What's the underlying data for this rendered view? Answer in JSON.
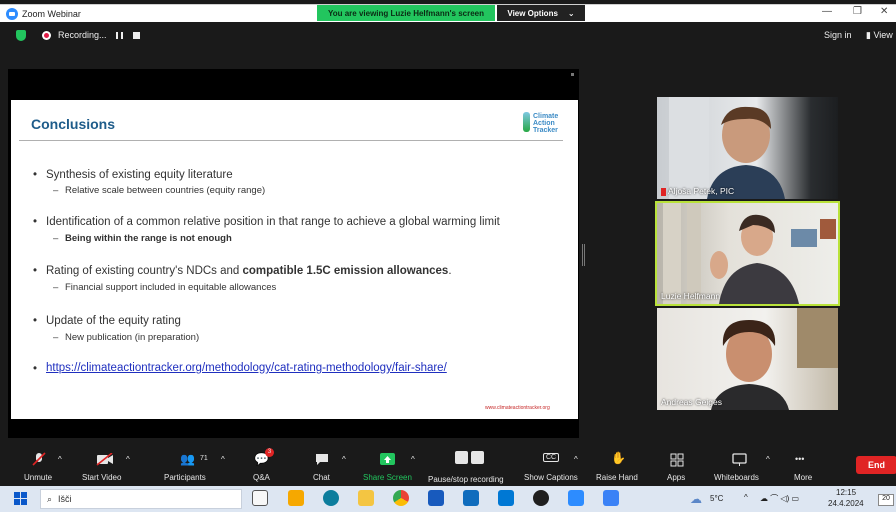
{
  "window": {
    "title": "Zoom Webinar",
    "minimize": "—",
    "restore": "❐",
    "close": "✕"
  },
  "banner": {
    "viewing": "You are viewing Luzie Helfmann's screen",
    "view_options": "View Options",
    "chevron": "⌄"
  },
  "topbar": {
    "recording": "Recording...",
    "sign_in": "Sign in",
    "view": "View"
  },
  "slide": {
    "title": "Conclusions",
    "logo": [
      "Climate",
      "Action",
      "Tracker"
    ],
    "bullets": [
      {
        "text": "Synthesis of existing equity literature",
        "sub": "Relative scale between countries (equity range)"
      },
      {
        "text": "Identification of a common relative position in that range to achieve a global warming limit",
        "sub": "Being within the range is not enough"
      },
      {
        "text_pre": "Rating of existing country's NDCs and ",
        "text_bold": "compatible 1.5C emission allowances",
        "text_post": ".",
        "sub": "Financial support included in equitable allowances"
      },
      {
        "text": "Update of the equity rating",
        "sub": "New publication (in preparation)"
      },
      {
        "link": "https://climateactiontracker.org/methodology/cat-rating-methodology/fair-share/"
      }
    ],
    "bullet_char": "•",
    "dash": "–",
    "footer": "www.climateactiontracker.org"
  },
  "participants": [
    {
      "name": "Aljoša Petek, PIC"
    },
    {
      "name": "Luzie Helfmann"
    },
    {
      "name": "Andreas Geiges"
    }
  ],
  "toolbar": {
    "unmute": "Unmute",
    "start_video": "Start Video",
    "participants": "Participants",
    "participants_count": "71",
    "qa": "Q&A",
    "qa_badge": "3",
    "chat": "Chat",
    "share_screen": "Share Screen",
    "pause_recording": "Pause/stop recording",
    "show_captions": "Show Captions",
    "cc": "CC",
    "raise_hand": "Raise Hand",
    "apps": "Apps",
    "whiteboards": "Whiteboards",
    "more": "More",
    "more_dots": "•••",
    "caret": "^",
    "end": "End"
  },
  "taskbar": {
    "search_placeholder": "Išči",
    "weather": "5°C",
    "time": "12:15",
    "date": "24.4.2024",
    "notif": "20"
  },
  "colors": {
    "accent_green": "#22c55e",
    "end_red": "#e02424",
    "slide_title": "#1e5c8a",
    "link": "#1f2fbf"
  }
}
